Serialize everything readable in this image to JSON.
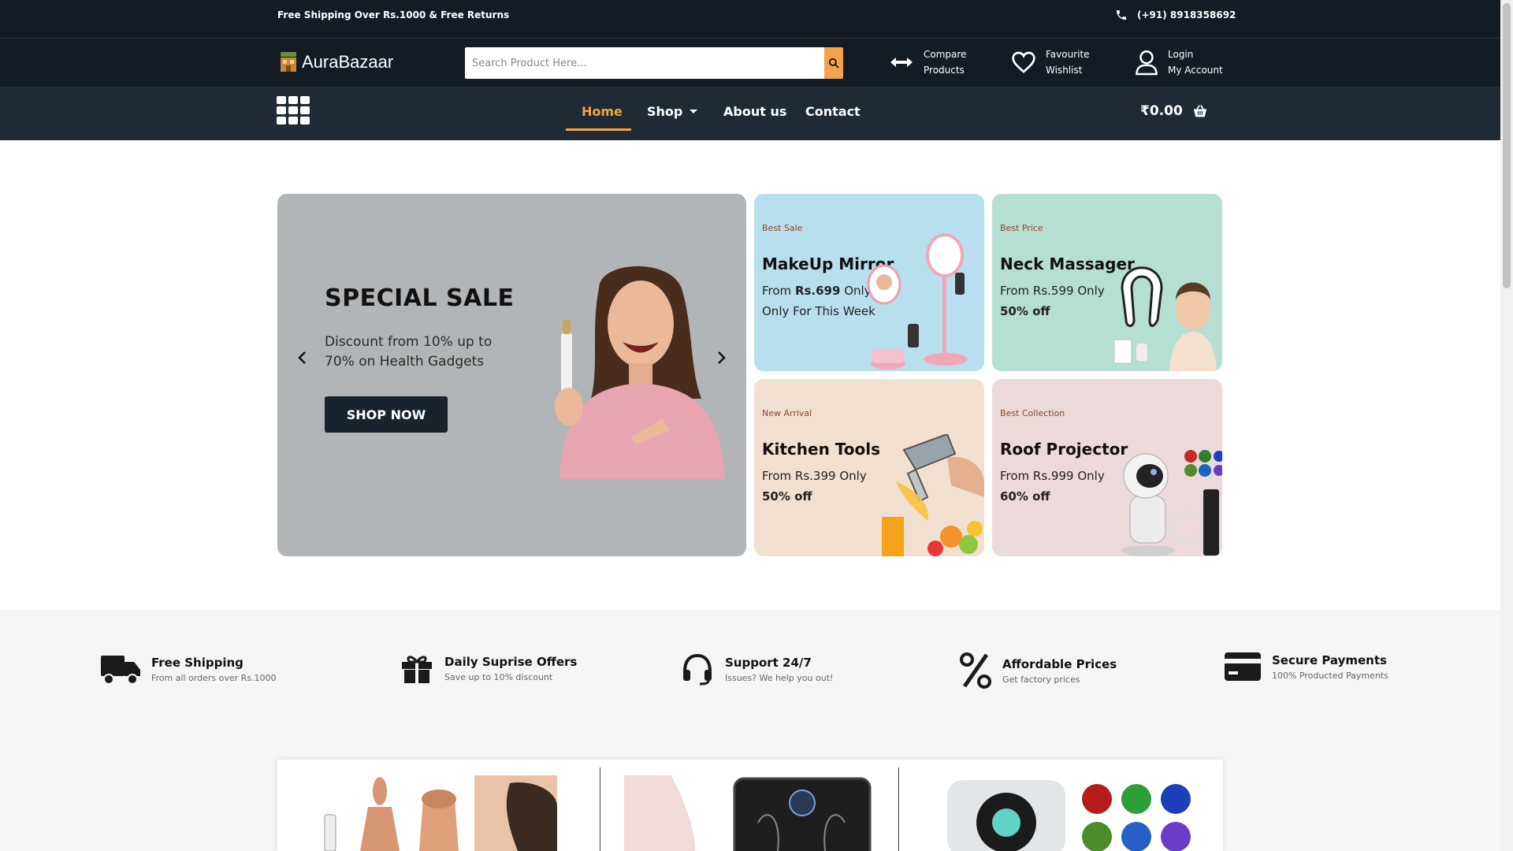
{
  "topbar": {
    "promo": "Free Shipping Over Rs.1000 & Free Returns",
    "phone": "(+91) 8918358692"
  },
  "header": {
    "logo_text": "AuraBazaar",
    "search_placeholder": "Search Product Here...",
    "compare": {
      "line1": "Compare",
      "line2": "Products"
    },
    "favourite": {
      "line1": "Favourite",
      "line2": "Wishlist"
    },
    "account": {
      "line1": "Login",
      "line2": "My Account"
    }
  },
  "nav": {
    "items": [
      {
        "label": "Home",
        "active": true
      },
      {
        "label": "Shop",
        "active": false
      },
      {
        "label": "About us",
        "active": false
      },
      {
        "label": "Contact",
        "active": false
      }
    ],
    "cart_total": "₹0.00"
  },
  "hero": {
    "title": "SPECIAL SALE",
    "subtitle": "Discount from 10% up to 70% on Health Gadgets",
    "button": "SHOP NOW"
  },
  "cards": [
    {
      "tag": "Best Sale",
      "name": "MakeUp Mirror",
      "line1_prefix": "From ",
      "line1_price": "Rs.699",
      "line1_suffix": " Only",
      "line2": "Only For This Week",
      "bg": "#b8dfee"
    },
    {
      "tag": "Best Price",
      "name": "Neck Massager",
      "line1": "From Rs.599 Only",
      "line2": "50% off",
      "bg": "#b6dfd3"
    },
    {
      "tag": "New Arrival",
      "name": "Kitchen Tools",
      "line1": "From Rs.399 Only",
      "line2": "50% off",
      "bg": "#f1e0d0"
    },
    {
      "tag": "Best Collection",
      "name": "Roof Projector",
      "line1": "From Rs.999 Only",
      "line2": "60% off",
      "bg": "#ecd9d9"
    }
  ],
  "features": [
    {
      "icon": "truck-icon",
      "title": "Free Shipping",
      "subtitle": "From all orders over Rs.1000"
    },
    {
      "icon": "gift-icon",
      "title": "Daily Suprise Offers",
      "subtitle": "Save up to 10% discount"
    },
    {
      "icon": "headset-icon",
      "title": "Support 24/7",
      "subtitle": "Issues? We help you out!"
    },
    {
      "icon": "percent-icon",
      "title": "Affordable Prices",
      "subtitle": "Get factory prices"
    },
    {
      "icon": "credit-card-icon",
      "title": "Secure Payments",
      "subtitle": "100% Producted Payments"
    }
  ],
  "colors": {
    "dark": "#131c24",
    "nav": "#1f2a35",
    "accent": "#f3a34a",
    "hero_bg": "#b1b5b7"
  }
}
